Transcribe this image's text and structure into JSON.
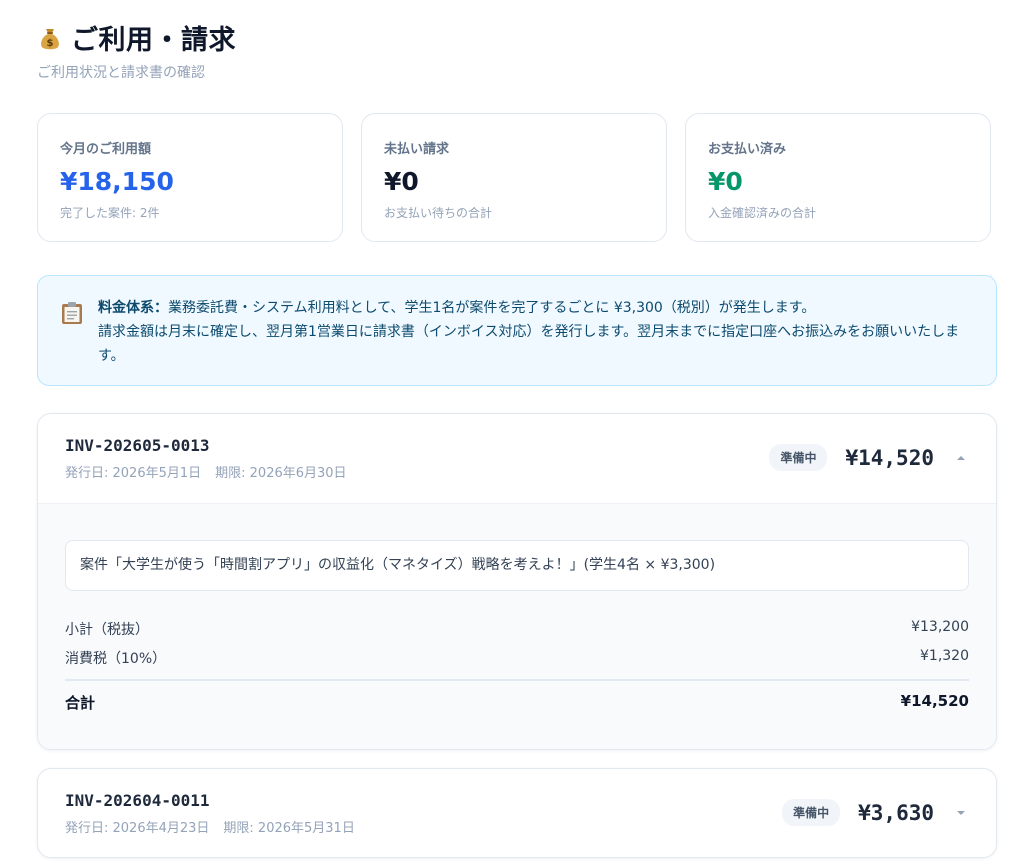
{
  "header": {
    "icon": "money-bag-icon",
    "title": "ご利用・請求",
    "subtitle": "ご利用状況と請求書の確認"
  },
  "stats": [
    {
      "label": "今月のご利用額",
      "value": "¥18,150",
      "sub": "完了した案件: 2件",
      "color": "#2563eb"
    },
    {
      "label": "未払い請求",
      "value": "¥0",
      "sub": "お支払い待ちの合計",
      "color": "#0f172a"
    },
    {
      "label": "お支払い済み",
      "value": "¥0",
      "sub": "入金確認済みの合計",
      "color": "#059669"
    }
  ],
  "notice": {
    "icon": "clipboard-icon",
    "strong": "料金体系：",
    "line1": "業務委託費・システム利用料として、学生1名が案件を完了するごとに ¥3,300（税別）が発生します。",
    "line2": "請求金額は月末に確定し、翌月第1営業日に請求書（インボイス対応）を発行します。翌月末までに指定口座へお振込みをお願いいたします。"
  },
  "invoices": [
    {
      "number": "INV-202605-0013",
      "issued": "発行日: 2026年5月1日",
      "due": "期限: 2026年6月30日",
      "status": "準備中",
      "amount": "¥14,520",
      "expanded": true,
      "item": "案件「大学生が使う「時間割アプリ」の収益化（マネタイズ）戦略を考えよ！」(学生4名 × ¥3,300)",
      "subtotal_label": "小計（税抜）",
      "subtotal": "¥13,200",
      "tax_label": "消費税（10%）",
      "tax": "¥1,320",
      "total_label": "合計",
      "total": "¥14,520"
    },
    {
      "number": "INV-202604-0011",
      "issued": "発行日: 2026年4月23日",
      "due": "期限: 2026年5月31日",
      "status": "準備中",
      "amount": "¥3,630",
      "expanded": false
    }
  ]
}
